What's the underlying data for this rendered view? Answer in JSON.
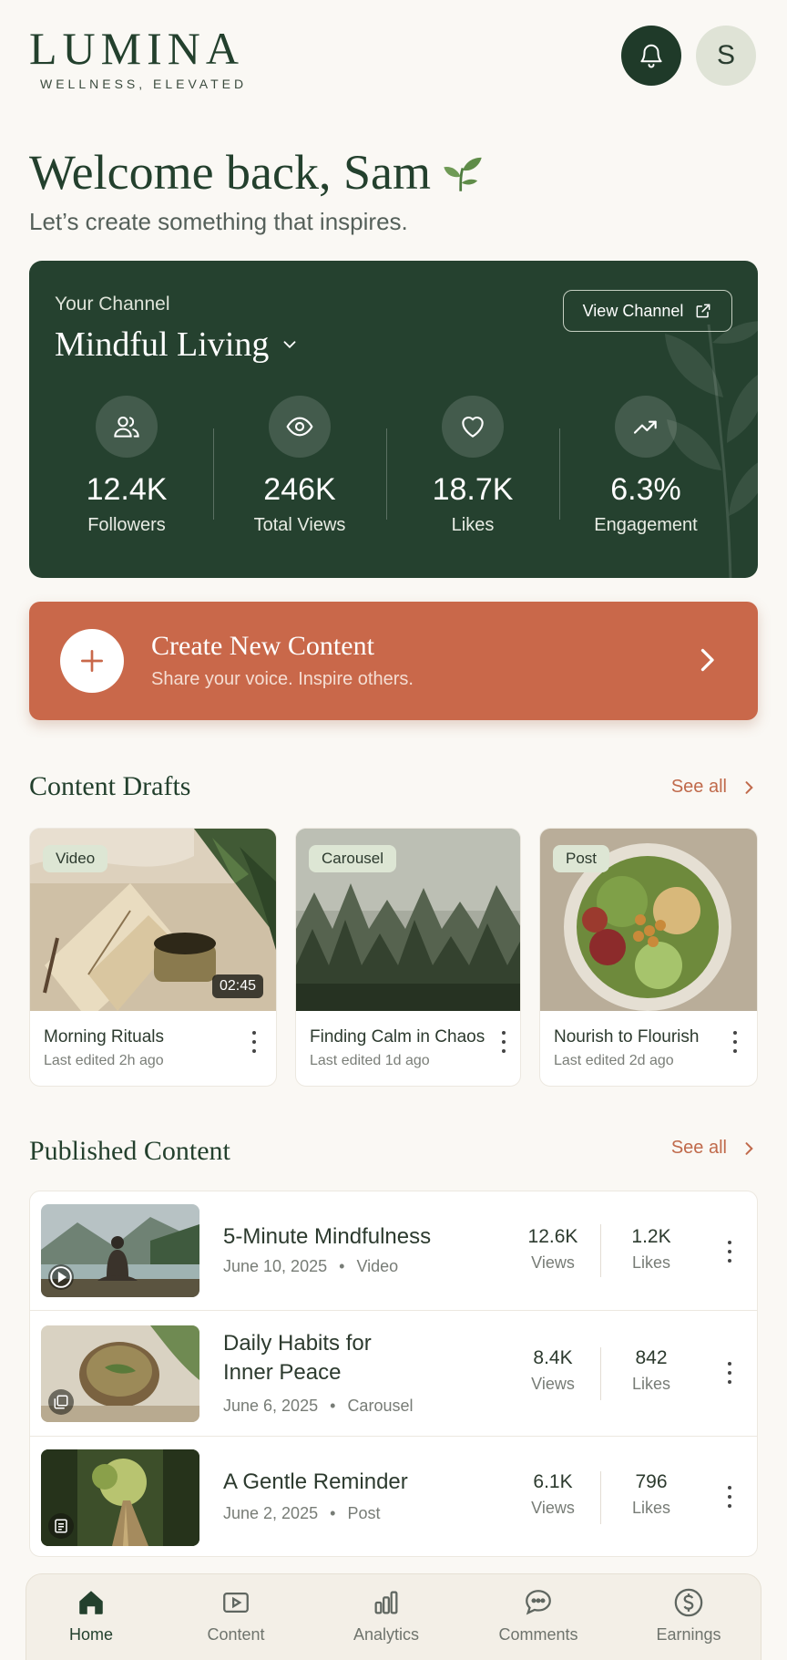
{
  "header": {
    "logo_title": "LUMINA",
    "logo_subtitle": "WELLNESS, ELEVATED",
    "avatar_initial": "S"
  },
  "welcome": {
    "heading": "Welcome back, Sam",
    "tagline": "Let’s create something that inspires."
  },
  "channel": {
    "label": "Your Channel",
    "name": "Mindful Living",
    "view_button": "View Channel",
    "stats": [
      {
        "icon": "followers-icon",
        "value": "12.4K",
        "label": "Followers"
      },
      {
        "icon": "eye-icon",
        "value": "246K",
        "label": "Total Views"
      },
      {
        "icon": "heart-icon",
        "value": "18.7K",
        "label": "Likes"
      },
      {
        "icon": "trending-up-icon",
        "value": "6.3%",
        "label": "Engagement"
      }
    ]
  },
  "create": {
    "title": "Create New Content",
    "subtitle": "Share your voice. Inspire others."
  },
  "drafts": {
    "heading": "Content Drafts",
    "see_all": "See all",
    "items": [
      {
        "tag": "Video",
        "duration": "02:45",
        "title": "Morning Rituals",
        "meta": "Last edited 2h ago"
      },
      {
        "tag": "Carousel",
        "title": "Finding Calm in Chaos",
        "meta": "Last edited 1d ago"
      },
      {
        "tag": "Post",
        "title": "Nourish to Flourish",
        "meta": "Last edited 2d ago"
      }
    ]
  },
  "published": {
    "heading": "Published Content",
    "see_all": "See all",
    "views_label": "Views",
    "likes_label": "Likes",
    "items": [
      {
        "title": "5-Minute Mindfulness",
        "date": "June 10, 2025",
        "type": "Video",
        "views": "12.6K",
        "likes": "1.2K"
      },
      {
        "title": "Daily Habits for Inner Peace",
        "date": "June 6, 2025",
        "type": "Carousel",
        "views": "8.4K",
        "likes": "842"
      },
      {
        "title": "A Gentle Reminder",
        "date": "June 2, 2025",
        "type": "Post",
        "views": "6.1K",
        "likes": "796"
      }
    ]
  },
  "nav": {
    "items": [
      {
        "label": "Home",
        "icon": "home-icon",
        "active": true
      },
      {
        "label": "Content",
        "icon": "play-box-icon"
      },
      {
        "label": "Analytics",
        "icon": "bar-chart-icon"
      },
      {
        "label": "Comments",
        "icon": "chat-bubble-icon"
      },
      {
        "label": "Earnings",
        "icon": "dollar-icon"
      }
    ]
  },
  "colors": {
    "brand_green": "#25412f",
    "accent_terracotta": "#c9684a",
    "background": "#faf8f4"
  }
}
